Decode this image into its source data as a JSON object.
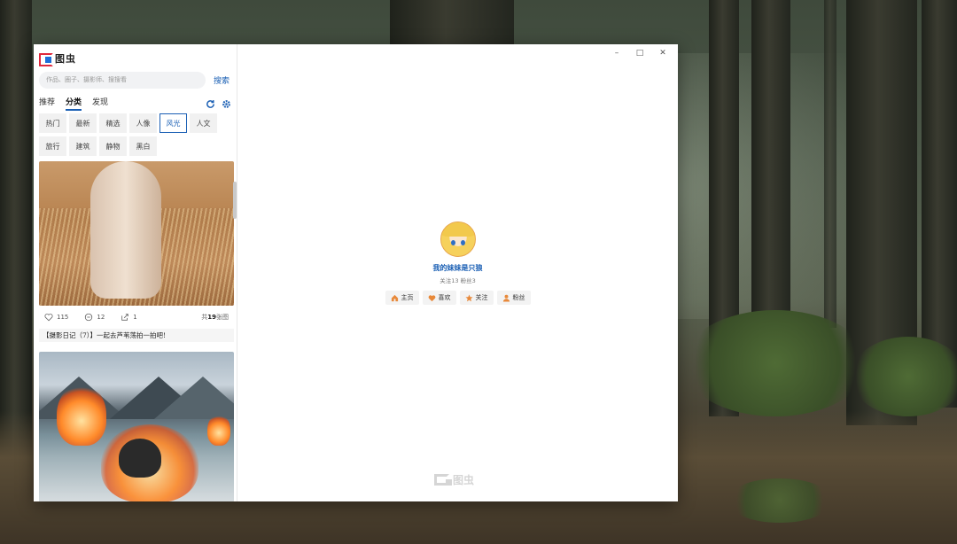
{
  "app": {
    "logo_text": "图虫"
  },
  "search": {
    "placeholder": "作品、圈子、摄影师、搜搜看",
    "button_label": "搜索"
  },
  "tabs": [
    {
      "label": "推荐",
      "active": false
    },
    {
      "label": "分类",
      "active": true
    },
    {
      "label": "发现",
      "active": false
    }
  ],
  "toolbar_icons": [
    "refresh-icon",
    "settings-icon"
  ],
  "categories": [
    {
      "label": "热门",
      "active": false
    },
    {
      "label": "最新",
      "active": false
    },
    {
      "label": "精选",
      "active": false
    },
    {
      "label": "人像",
      "active": false
    },
    {
      "label": "风光",
      "active": true
    },
    {
      "label": "人文",
      "active": false
    },
    {
      "label": "旅行",
      "active": false
    },
    {
      "label": "建筑",
      "active": false
    },
    {
      "label": "静物",
      "active": false
    },
    {
      "label": "黑白",
      "active": false
    }
  ],
  "feed": [
    {
      "likes": "115",
      "comments": "12",
      "shares": "1",
      "pics_prefix": "共",
      "pics_count": "19",
      "pics_suffix": "张图",
      "caption": "【摄影日记（7）】一起去芦苇荡拍一拍吧!"
    }
  ],
  "window_controls": {
    "minimize": "–",
    "maximize": "□",
    "close": "✕"
  },
  "profile": {
    "username": "我的妹妹是只狼",
    "follow_info": "关注13  粉丝3",
    "buttons": [
      {
        "label": "主页",
        "icon": "home-icon",
        "color": "#e8893a"
      },
      {
        "label": "喜欢",
        "icon": "heart-icon",
        "color": "#e8893a"
      },
      {
        "label": "关注",
        "icon": "star-icon",
        "color": "#e8893a"
      },
      {
        "label": "粉丝",
        "icon": "person-icon",
        "color": "#e8893a"
      }
    ]
  },
  "watermark": {
    "text": "图虫"
  },
  "colors": {
    "accent": "#1a5fb4",
    "logo_red": "#e0283c",
    "button_icon": "#e8893a"
  }
}
